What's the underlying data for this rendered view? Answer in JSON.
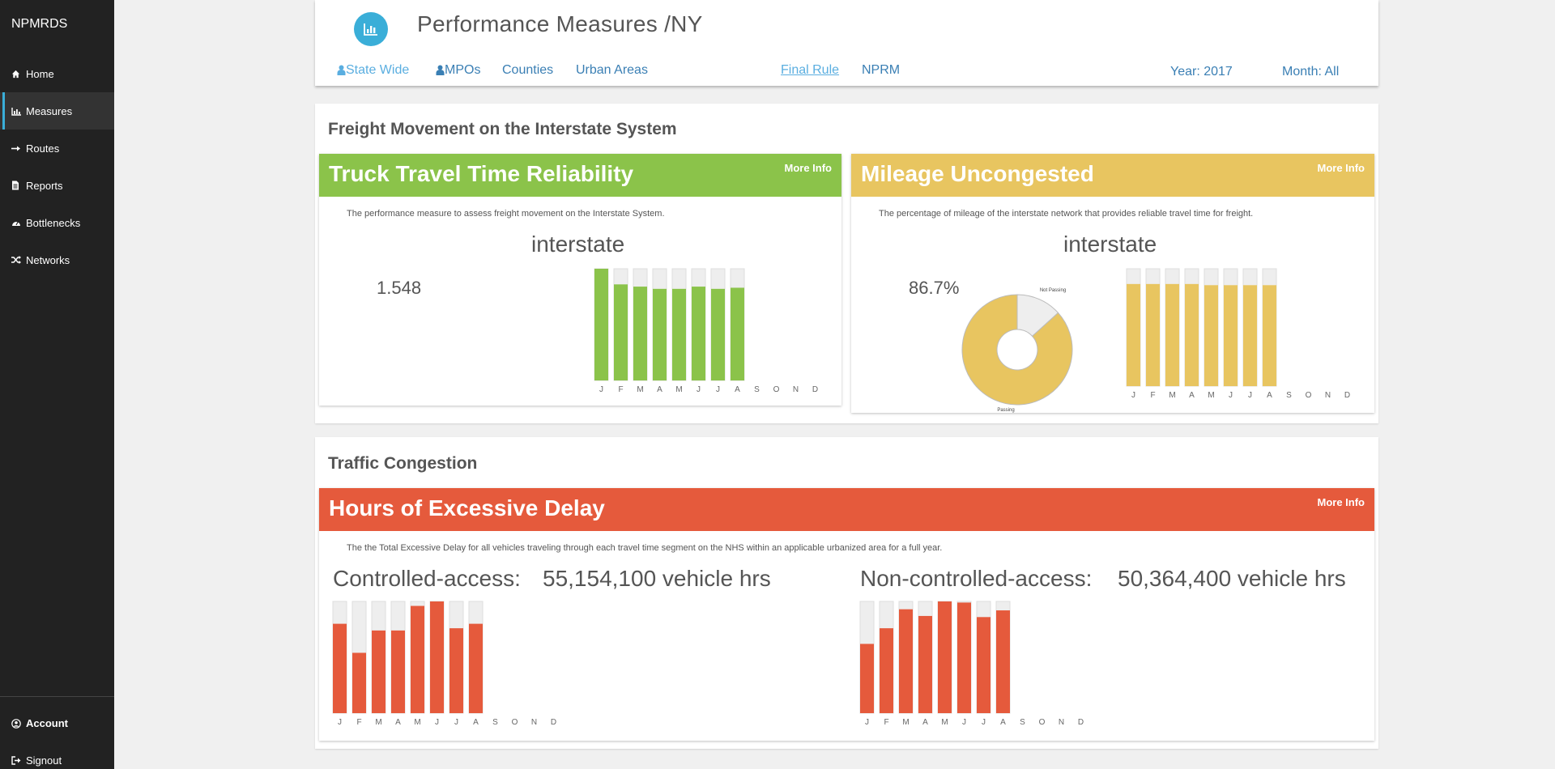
{
  "sidebar": {
    "brand": "NPMRDS",
    "items": [
      {
        "label": "Home",
        "icon": "home-icon"
      },
      {
        "label": "Measures",
        "icon": "bar-chart-icon"
      },
      {
        "label": "Routes",
        "icon": "arrow-right-icon"
      },
      {
        "label": "Reports",
        "icon": "document-icon"
      },
      {
        "label": "Bottlenecks",
        "icon": "dashboard-icon"
      },
      {
        "label": "Networks",
        "icon": "shuffle-icon"
      }
    ],
    "active": "Measures",
    "account": "Account",
    "signout": "Signout"
  },
  "header": {
    "title": "Performance Measures /NY",
    "links": {
      "state_wide": "State Wide",
      "mpos": "MPOs",
      "counties": "Counties",
      "urban_areas": "Urban Areas",
      "final_rule": "Final Rule",
      "nprm": "NPRM",
      "year": "Year: 2017",
      "month": "Month: All"
    }
  },
  "freight": {
    "title": "Freight Movement on the Interstate System",
    "ttr": {
      "title": "Truck Travel Time Reliability",
      "more_info": "More Info",
      "description": "The performance measure to assess freight movement on the Interstate System.",
      "subtitle": "interstate",
      "value": "1.548",
      "color": "#8bc34a"
    },
    "mileage": {
      "title": "Mileage Uncongested",
      "more_info": "More Info",
      "description": "The percentage of mileage of the interstate network that provides reliable travel time for freight.",
      "subtitle": "interstate",
      "value": "86.7%",
      "color": "#e8c560",
      "pie_labels": {
        "not_passing": "Not Passing",
        "passing": "Passing"
      }
    }
  },
  "congestion": {
    "title": "Traffic Congestion",
    "phed": {
      "title": "Hours of Excessive Delay",
      "more_info": "More Info",
      "description": "The the Total Excessive Delay for all vehicles traveling through each travel time segment on the NHS within an applicable urbanized area for a full year.",
      "controlled_label": "Controlled-access:",
      "controlled_value": "55,154,100 vehicle hrs",
      "noncontrolled_label": "Non-controlled-access:",
      "noncontrolled_value": "50,364,400 vehicle hrs",
      "color": "#e55a3c"
    }
  },
  "chart_data": [
    {
      "type": "bar",
      "name": "ttr-monthly",
      "categories": [
        "J",
        "F",
        "M",
        "A",
        "M",
        "J",
        "J",
        "A",
        "S",
        "O",
        "N",
        "D"
      ],
      "values": [
        1.0,
        0.86,
        0.84,
        0.82,
        0.82,
        0.84,
        0.82,
        0.83,
        null,
        null,
        null,
        null
      ],
      "ylim": [
        0,
        1
      ],
      "color": "#8bc34a"
    },
    {
      "type": "pie",
      "name": "mileage-pie",
      "categories": [
        "Passing",
        "Not Passing"
      ],
      "values": [
        86.7,
        13.3
      ],
      "colors": [
        "#e8c560",
        "#eeeeee"
      ]
    },
    {
      "type": "bar",
      "name": "mileage-monthly",
      "categories": [
        "J",
        "F",
        "M",
        "A",
        "M",
        "J",
        "J",
        "A",
        "S",
        "O",
        "N",
        "D"
      ],
      "values": [
        0.87,
        0.87,
        0.87,
        0.87,
        0.86,
        0.86,
        0.86,
        0.86,
        null,
        null,
        null,
        null
      ],
      "ylim": [
        0,
        1
      ],
      "color": "#e8c560"
    },
    {
      "type": "bar",
      "name": "phed-controlled-monthly",
      "categories": [
        "J",
        "F",
        "M",
        "A",
        "M",
        "J",
        "J",
        "A",
        "S",
        "O",
        "N",
        "D"
      ],
      "values": [
        0.8,
        0.54,
        0.74,
        0.74,
        0.96,
        1.0,
        0.76,
        0.8,
        null,
        null,
        null,
        null
      ],
      "ylim": [
        0,
        1
      ],
      "color": "#e55a3c"
    },
    {
      "type": "bar",
      "name": "phed-noncontrolled-monthly",
      "categories": [
        "J",
        "F",
        "M",
        "A",
        "M",
        "J",
        "J",
        "A",
        "S",
        "O",
        "N",
        "D"
      ],
      "values": [
        0.62,
        0.76,
        0.93,
        0.87,
        1.0,
        0.99,
        0.86,
        0.92,
        null,
        null,
        null,
        null
      ],
      "ylim": [
        0,
        1
      ],
      "color": "#e55a3c"
    }
  ]
}
